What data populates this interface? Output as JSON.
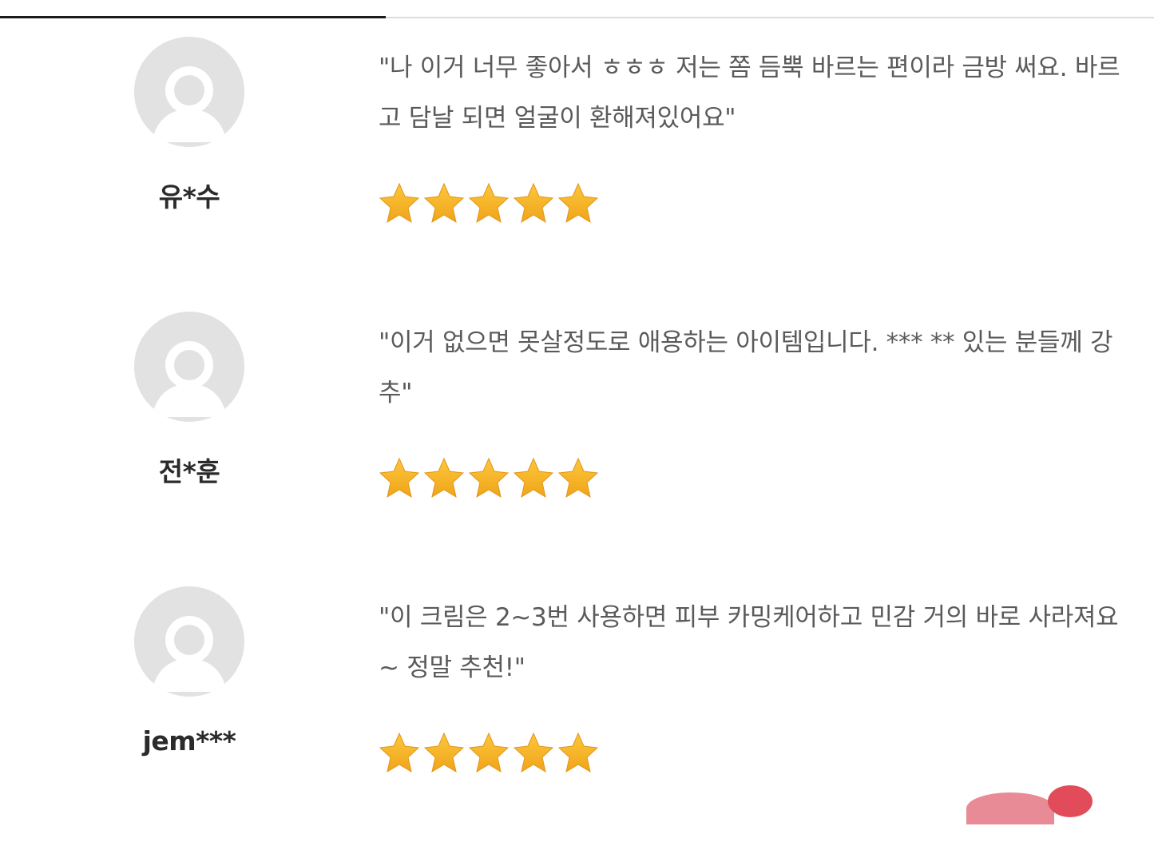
{
  "reviews": [
    {
      "reviewer": "유*수",
      "text": "\"나 이거 너무 좋아서 ㅎㅎㅎ 저는 쫌 듬뿍 바르는 편이라 금방 써요. 바르고 담날 되면 얼굴이 환해져있어요\"",
      "rating": 5,
      "rating_max": 5
    },
    {
      "reviewer": "전*훈",
      "text": "\"이거 없으면 못살정도로 애용하는 아이템입니다. *** ** 있는 분들께 강추\"",
      "rating": 5,
      "rating_max": 5
    },
    {
      "reviewer": "jem***",
      "text": "\"이 크림은 2~3번 사용하면 피부 카밍케어하고 민감 거의 바로 사라져요~ 정말 추천!\"",
      "rating": 5,
      "rating_max": 5
    }
  ],
  "icons": {
    "avatar": "user-placeholder-icon",
    "star": "star-icon"
  },
  "colors": {
    "star_fill": "#f7b22b",
    "avatar_bg": "#e2e2e2",
    "text": "#5a5a5a",
    "name": "#2b2b2b",
    "tab_active": "#1c1c1c"
  }
}
